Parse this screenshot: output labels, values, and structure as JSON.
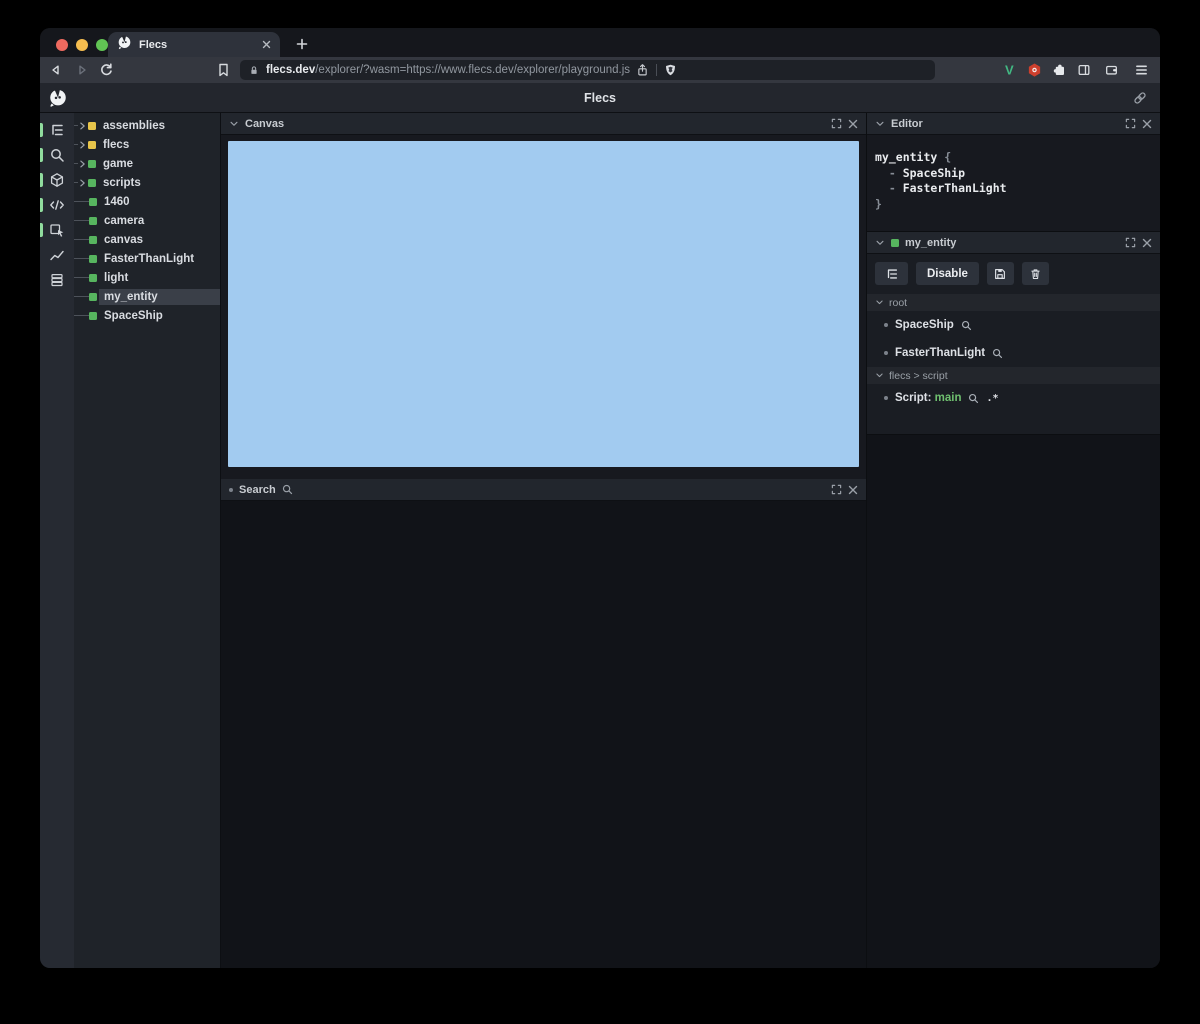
{
  "colors": {
    "traffic_red": "#ee6a5f",
    "traffic_yellow": "#f5bd4f",
    "traffic_green": "#61c454",
    "canvas_blue": "#a2cbf0",
    "entity_green": "#57b55f",
    "module_yellow": "#e7c54b",
    "indicator_green": "#90dc9e",
    "script_green": "#6fc06f",
    "vue_green": "#42b883",
    "ext_red": "#cd3f2d"
  },
  "browser": {
    "tab_title": "Flecs",
    "url_domain": "flecs.dev",
    "url_path": "/explorer/?wasm=https://www.flecs.dev/explorer/playground.js",
    "extensions_v_label": "V"
  },
  "app": {
    "title": "Flecs"
  },
  "sidebar": {
    "icons": [
      {
        "name": "tree-icon",
        "active": true
      },
      {
        "name": "search-icon",
        "active": true
      },
      {
        "name": "cube-icon",
        "active": true
      },
      {
        "name": "code-icon",
        "active": true
      },
      {
        "name": "inspect-icon",
        "active": true
      },
      {
        "name": "chart-icon",
        "active": false
      },
      {
        "name": "rows-icon",
        "active": false
      }
    ]
  },
  "tree": {
    "items": [
      {
        "label": "assemblies",
        "color": "yellow",
        "expandable": true,
        "selected": false
      },
      {
        "label": "flecs",
        "color": "yellow",
        "expandable": true,
        "selected": false
      },
      {
        "label": "game",
        "color": "green",
        "expandable": true,
        "selected": false
      },
      {
        "label": "scripts",
        "color": "green",
        "expandable": true,
        "selected": false
      },
      {
        "label": "1460",
        "color": "green",
        "expandable": false,
        "selected": false
      },
      {
        "label": "camera",
        "color": "green",
        "expandable": false,
        "selected": false
      },
      {
        "label": "canvas",
        "color": "green",
        "expandable": false,
        "selected": false
      },
      {
        "label": "FasterThanLight",
        "color": "green",
        "expandable": false,
        "selected": false
      },
      {
        "label": "light",
        "color": "green",
        "expandable": false,
        "selected": false
      },
      {
        "label": "my_entity",
        "color": "green",
        "expandable": false,
        "selected": true
      },
      {
        "label": "SpaceShip",
        "color": "green",
        "expandable": false,
        "selected": false
      }
    ]
  },
  "panels": {
    "canvas": {
      "title": "Canvas"
    },
    "search": {
      "title": "Search"
    },
    "editor": {
      "title": "Editor",
      "code": [
        {
          "parts": [
            {
              "text": "my_entity",
              "style": "name"
            },
            {
              "text": " {",
              "style": "punct"
            }
          ]
        },
        {
          "parts": [
            {
              "text": "  - ",
              "style": "punct"
            },
            {
              "text": "SpaceShip",
              "style": "name"
            }
          ]
        },
        {
          "parts": [
            {
              "text": "  - ",
              "style": "punct"
            },
            {
              "text": "FasterThanLight",
              "style": "name"
            }
          ]
        },
        {
          "parts": [
            {
              "text": "}",
              "style": "punct"
            }
          ]
        }
      ]
    },
    "entity": {
      "title": "my_entity",
      "toolbar": {
        "disable_label": "Disable"
      },
      "sections": [
        {
          "title": "root",
          "items": [
            {
              "parts": [
                {
                  "text": "SpaceShip",
                  "style": "name"
                }
              ],
              "icons": [
                "magnifier"
              ]
            },
            {
              "parts": [
                {
                  "text": "FasterThanLight",
                  "style": "name"
                }
              ],
              "icons": [
                "magnifier"
              ]
            }
          ]
        },
        {
          "title": "flecs > script",
          "items": [
            {
              "parts": [
                {
                  "text": "Script: ",
                  "style": "name"
                },
                {
                  "text": "main",
                  "style": "green"
                }
              ],
              "icons": [
                "magnifier",
                "regex"
              ]
            }
          ]
        }
      ]
    }
  }
}
